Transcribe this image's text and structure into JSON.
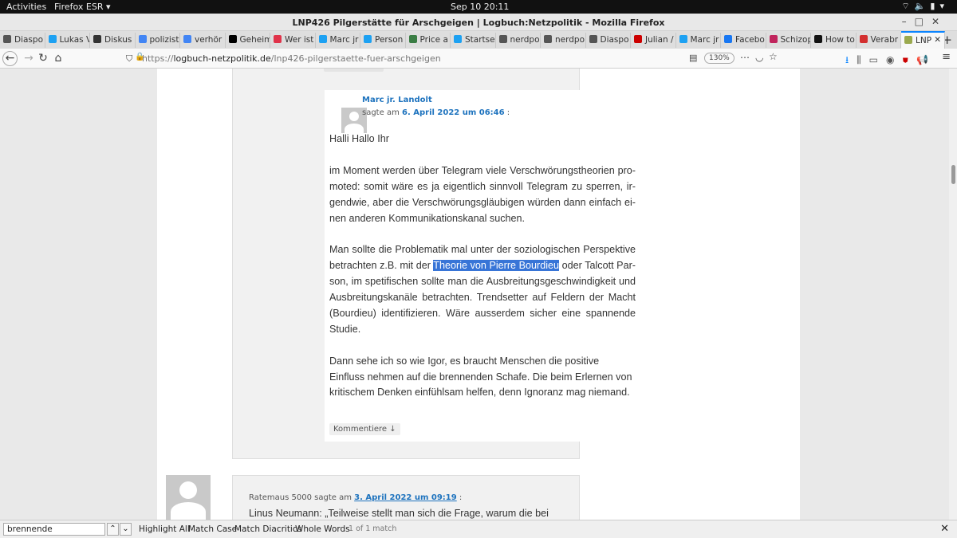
{
  "topbar": {
    "activities": "Activities",
    "app": "Firefox ESR ▾",
    "clock": "Sep 10  20:11"
  },
  "window": {
    "title": "LNP426 Pilgerstätte für Arschgeigen | Logbuch:Netzpolitik - Mozilla Firefox"
  },
  "tabs": [
    {
      "label": "Diaspo",
      "color": "#555"
    },
    {
      "label": "Lukas V",
      "color": "#1da1f2"
    },
    {
      "label": "Diskus",
      "color": "#333"
    },
    {
      "label": "polizist",
      "color": "#4285f4"
    },
    {
      "label": "verhör",
      "color": "#4285f4"
    },
    {
      "label": "Geheim",
      "color": "#000"
    },
    {
      "label": "Wer ist",
      "color": "#e0334a"
    },
    {
      "label": "Marc jr",
      "color": "#1da1f2"
    },
    {
      "label": "Person",
      "color": "#1da1f2"
    },
    {
      "label": "Price a",
      "color": "#3a7d44"
    },
    {
      "label": "Startse",
      "color": "#1da1f2"
    },
    {
      "label": "nerdpo",
      "color": "#555"
    },
    {
      "label": "nerdpo",
      "color": "#555"
    },
    {
      "label": "Diaspo",
      "color": "#555"
    },
    {
      "label": "Julian /",
      "color": "#c00"
    },
    {
      "label": "Marc jr",
      "color": "#1da1f2"
    },
    {
      "label": "Facebo",
      "color": "#1877f2"
    },
    {
      "label": "Schizop",
      "color": "#c0245c"
    },
    {
      "label": "How to",
      "color": "#111"
    },
    {
      "label": "Verabr",
      "color": "#d32f2f"
    },
    {
      "label": "LNP",
      "color": "#9aa94e",
      "active": true
    }
  ],
  "navbar": {
    "url_prefix": "https://",
    "url_domain": "logbuch-netzpolitik.de",
    "url_path": "/lnp426-pilgerstaette-fuer-arschgeigen",
    "zoom": "130%"
  },
  "reply": {
    "author": "Marc jr. Landolt",
    "said_prefix": "sagte am ",
    "date": "6. April 2022 um 06:46",
    "said_suffix": " :",
    "p1": "Halli Hallo Ihr",
    "p2": "im Moment werden über Telegram viele Verschwörungstheorien pro­moted: somit wäre es ja eigentlich sinnvoll Telegram zu sperren, ir­gendwie, aber die Verschwörungsgläubigen würden dann einfach ei­nen anderen Kommunikationskanal suchen.",
    "p3_before": "Man sollte die Problematik mal unter der soziologischen Perspektive betrachten z.B. mit der ",
    "p3_link": "Theorie von Pierre Bourdieu",
    "p3_after": " oder Talcott Par­son, im spetifischen sollte man die Ausbreitungsgeschwindigkeit und Ausbreitungskanäle betrachten. Trendsetter auf Feldern der Macht (Bourdieu) identifizieren. Wäre ausserdem sicher eine spannende Stu­die.",
    "p4": "Dann sehe ich so wie Igor, es braucht Menschen die positive Einfluss nehmen auf die brennenden Schafe. Die beim Erlernen von kritischem Denken einfühlsam helfen, denn Ignoranz mag niemand.",
    "reply_label": "Kommentiere ↓"
  },
  "comment2": {
    "author": "Ratemaus 5000",
    "said": " sagte am ",
    "date": "3. April 2022 um 09:19",
    "suffix": " :",
    "first_line": "Linus Neumann: „Teilweise stellt man sich die Frage, warum die bei"
  },
  "findbar": {
    "query": "brennende",
    "highlight_all": "Highlight All",
    "match_case": "Match Case",
    "match_diacritics": "Match Diacritics",
    "whole_words": "Whole Words",
    "count": "1 of 1 match"
  }
}
